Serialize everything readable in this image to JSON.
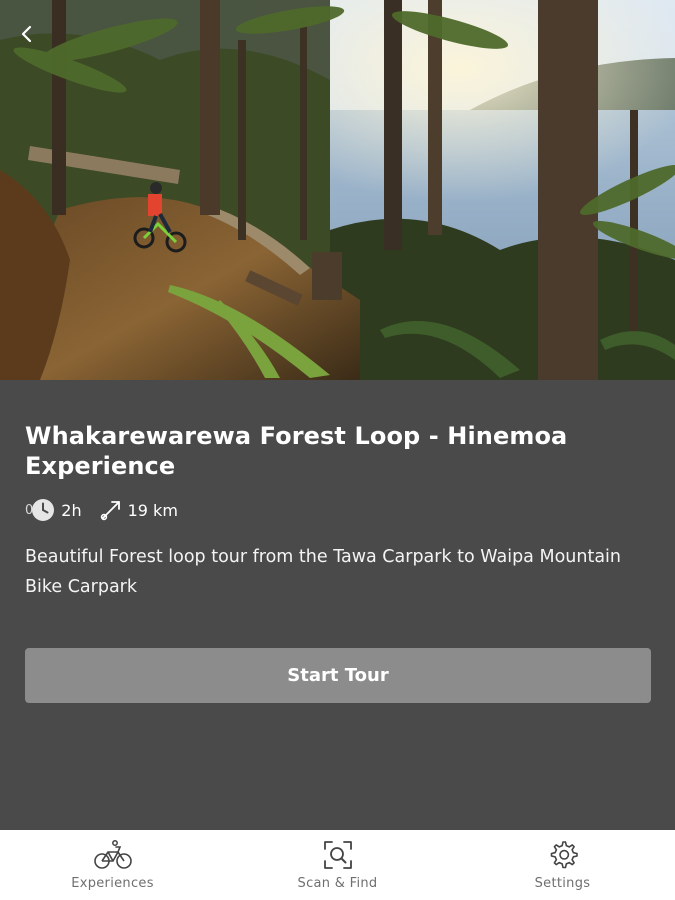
{
  "hero": {
    "image_alt": "forest-trail-with-mountain-biker-and-lake",
    "back_icon": "chevron-left-icon"
  },
  "tour": {
    "title": "Whakarewarewa Forest Loop - Hinemoa Experience",
    "prefix": "0",
    "duration": "2h",
    "distance": "19 km",
    "description": "Beautiful Forest loop tour from the Tawa Carpark to Waipa Mountain Bike Carpark",
    "start_label": "Start Tour"
  },
  "nav": {
    "items": [
      {
        "label": "Experiences",
        "icon": "bicycle-icon"
      },
      {
        "label": "Scan & Find",
        "icon": "scan-search-icon"
      },
      {
        "label": "Settings",
        "icon": "gear-icon"
      }
    ]
  },
  "colors": {
    "panel": "#4a4a4a",
    "button": "#8c8c8c",
    "nav_bg": "#ffffff",
    "nav_text": "#6f6f6f"
  }
}
